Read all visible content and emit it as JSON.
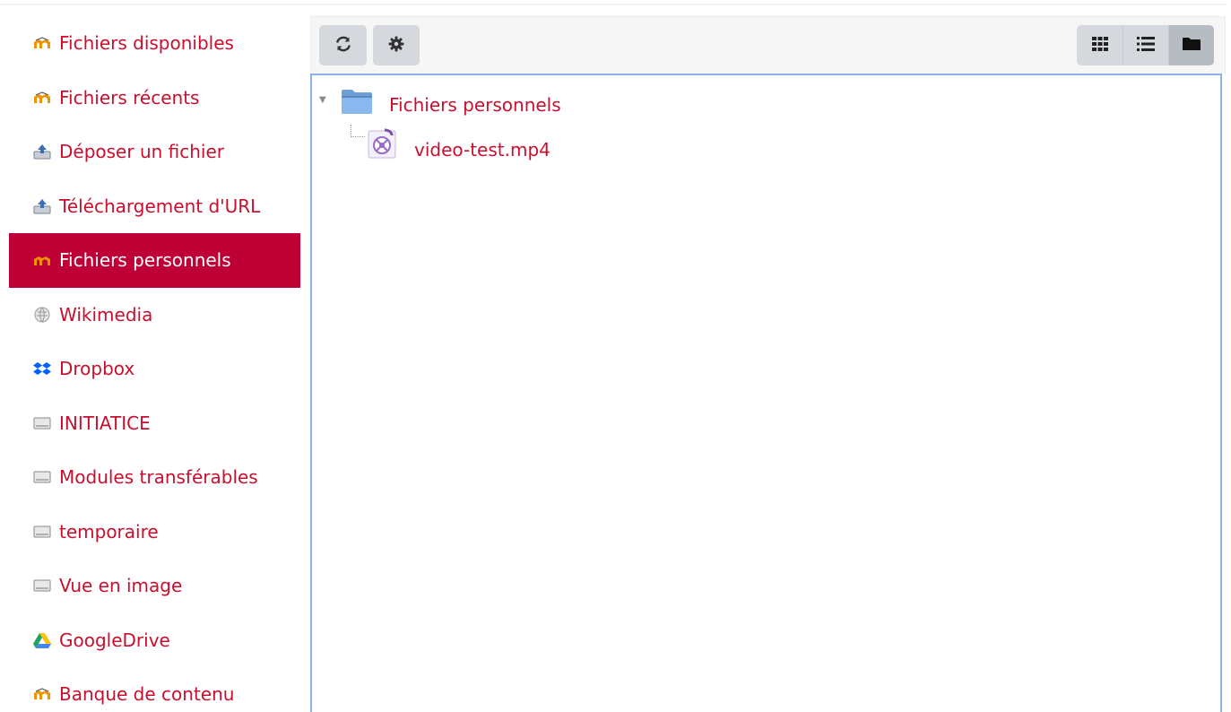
{
  "sidebar": {
    "items": [
      {
        "label": "Fichiers disponibles",
        "icon": "moodle-icon"
      },
      {
        "label": "Fichiers récents",
        "icon": "moodle-icon"
      },
      {
        "label": "Déposer un fichier",
        "icon": "upload-icon"
      },
      {
        "label": "Téléchargement d'URL",
        "icon": "upload-icon"
      },
      {
        "label": "Fichiers personnels",
        "icon": "moodle-icon",
        "active": true
      },
      {
        "label": "Wikimedia",
        "icon": "wikimedia-icon"
      },
      {
        "label": "Dropbox",
        "icon": "dropbox-icon"
      },
      {
        "label": "INITIATICE",
        "icon": "repository-icon"
      },
      {
        "label": "Modules transférables",
        "icon": "repository-icon"
      },
      {
        "label": "temporaire",
        "icon": "repository-icon"
      },
      {
        "label": "Vue en image",
        "icon": "repository-icon"
      },
      {
        "label": "GoogleDrive",
        "icon": "google-drive-icon"
      },
      {
        "label": "Banque de contenu",
        "icon": "moodle-icon"
      }
    ]
  },
  "toolbar": {
    "buttons": [
      "refresh-icon",
      "gear-icon"
    ],
    "views": [
      "grid-view-icon",
      "list-view-icon",
      "folder-view-icon"
    ],
    "active_view": "folder-view-icon"
  },
  "tree": {
    "folder": {
      "name": "Fichiers personnels",
      "expanded": true,
      "icon": "folder-icon"
    },
    "files": [
      {
        "name": "video-test.mp4",
        "icon": "video-file-icon"
      }
    ]
  },
  "colors": {
    "accent": "#c8102e",
    "active_background": "#bf0036",
    "content_border": "#8cb0e8",
    "button_background": "#d5d8dc"
  }
}
